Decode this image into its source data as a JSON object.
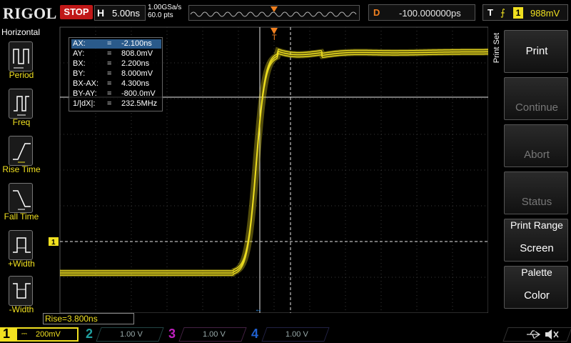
{
  "top": {
    "logo": "RIGOL",
    "run_status": "STOP",
    "time_label": "H",
    "time_base": "5.00ns",
    "sample_rate": "1.00GSa/s",
    "mem_depth": "60.0 pts",
    "delay_label": "D",
    "delay_value": "-100.000000ps",
    "trigger_label": "T",
    "trigger_edge": "⨍",
    "trigger_source": "1",
    "trigger_level": "988mV"
  },
  "left_panel": {
    "title": "Horizontal",
    "items": [
      {
        "label": "Period",
        "icon": "period-icon"
      },
      {
        "label": "Freq",
        "icon": "freq-icon"
      },
      {
        "label": "Rise Time",
        "icon": "rise-time-icon"
      },
      {
        "label": "Fall Time",
        "icon": "fall-time-icon"
      },
      {
        "label": "+Width",
        "icon": "pos-width-icon"
      },
      {
        "label": "-Width",
        "icon": "neg-width-icon"
      }
    ]
  },
  "cursor_table": {
    "rows": [
      {
        "key": "AX:",
        "eq": "=",
        "value": "-2.100ns"
      },
      {
        "key": "AY:",
        "eq": "=",
        "value": "808.0mV"
      },
      {
        "key": "BX:",
        "eq": "=",
        "value": "2.200ns"
      },
      {
        "key": "BY:",
        "eq": "=",
        "value": "8.000mV"
      },
      {
        "key": "BX-AX:",
        "eq": "=",
        "value": "4.300ns"
      },
      {
        "key": "BY-AY:",
        "eq": "=",
        "value": "-800.0mV"
      },
      {
        "key": "1/|dX|:",
        "eq": "=",
        "value": "232.5MHz"
      }
    ]
  },
  "right_panel": {
    "menu_title": "Print Set",
    "buttons": [
      {
        "top": "",
        "main": "Print",
        "enabled": true
      },
      {
        "top": "",
        "main": "Continue",
        "enabled": false
      },
      {
        "top": "",
        "main": "Abort",
        "enabled": false
      },
      {
        "top": "",
        "main": "Status",
        "enabled": false
      },
      {
        "top": "Print Range",
        "main": "Screen",
        "enabled": true
      },
      {
        "top": "Palette",
        "main": "Color",
        "enabled": true
      }
    ]
  },
  "measurement": {
    "rise": "Rise=3.800ns"
  },
  "channels": [
    {
      "num": "1",
      "scale": "200mV",
      "color": "#f0e020",
      "active": true
    },
    {
      "num": "2",
      "scale": "1.00 V",
      "color": "#20a0a0",
      "active": false
    },
    {
      "num": "3",
      "scale": "1.00 V",
      "color": "#c020c0",
      "active": false
    },
    {
      "num": "4",
      "scale": "1.00 V",
      "color": "#2060d0",
      "active": false
    }
  ],
  "markers": {
    "ch1_ground": "1",
    "trigger_pos": "T"
  },
  "colors": {
    "trace": "#f0e020",
    "grid": "#3a3a3a",
    "trigger": "#f08020"
  }
}
